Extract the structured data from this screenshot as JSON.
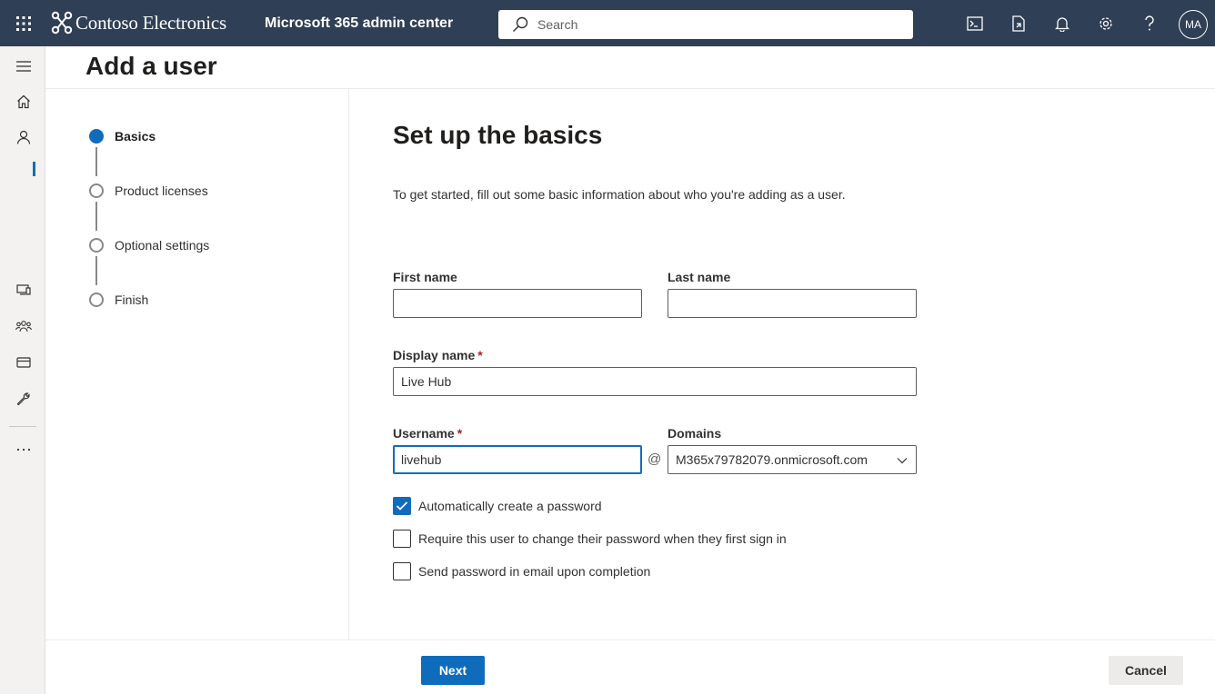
{
  "topbar": {
    "brand": "Contoso Electronics",
    "app_title": "Microsoft 365 admin center",
    "search_placeholder": "Search",
    "avatar_initials": "MA",
    "background": "#2f3f55",
    "icons": [
      "app-launcher-icon",
      "terminal-icon",
      "document-icon",
      "bell-icon",
      "gear-icon",
      "help-icon"
    ]
  },
  "leftnav": {
    "icons": [
      "hamburger-icon",
      "home-icon",
      "user-icon",
      "devices-icon",
      "teams-icon",
      "billing-icon",
      "setup-icon",
      "more-icon"
    ]
  },
  "page": {
    "title": "Add a user"
  },
  "steps": [
    {
      "label": "Basics",
      "state": "current"
    },
    {
      "label": "Product licenses",
      "state": "pending"
    },
    {
      "label": "Optional settings",
      "state": "pending"
    },
    {
      "label": "Finish",
      "state": "pending"
    }
  ],
  "form": {
    "title": "Set up the basics",
    "intro": "To get started, fill out some basic information about who you're adding as a user.",
    "first_name": {
      "label": "First name",
      "value": ""
    },
    "last_name": {
      "label": "Last name",
      "value": ""
    },
    "display_name": {
      "label": "Display name",
      "required_mark": "*",
      "value": "Live Hub"
    },
    "username": {
      "label": "Username",
      "required_mark": "*",
      "value": "livehub"
    },
    "at_symbol": "@",
    "domains": {
      "label": "Domains",
      "value": "M365x79782079.onmicrosoft.com"
    },
    "checkboxes": [
      {
        "label": "Automatically create a password",
        "checked": true
      },
      {
        "label": "Require this user to change their password when they first sign in",
        "checked": false
      },
      {
        "label": "Send password in email upon completion",
        "checked": false
      }
    ]
  },
  "footer": {
    "next_label": "Next",
    "cancel_label": "Cancel"
  },
  "colors": {
    "accent": "#0f6cbd",
    "required": "#a4262c"
  }
}
